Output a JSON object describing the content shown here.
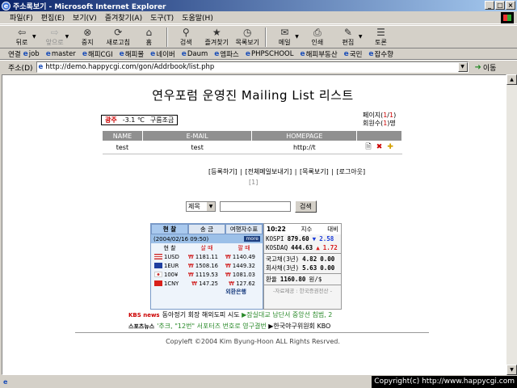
{
  "window": {
    "title": "주소록보기 - Microsoft Internet Explorer",
    "icon": "e"
  },
  "winbuttons": {
    "min": "_",
    "max": "□",
    "close": "×"
  },
  "menu": [
    "파일(F)",
    "편집(E)",
    "보기(V)",
    "즐겨찾기(A)",
    "도구(T)",
    "도움말(H)"
  ],
  "toolbar": {
    "back": "뒤로",
    "forward": "앞으로",
    "stop": "중지",
    "refresh": "새로고침",
    "home": "홈",
    "search": "검색",
    "favorites": "즐겨찾기",
    "history": "목록보기",
    "mail": "메일",
    "print": "인쇄",
    "edit": "편집",
    "discuss": "토론"
  },
  "links": {
    "label": "연결",
    "items": [
      "job",
      "master",
      "해피CGI",
      "해피몰",
      "네이버",
      "Daum",
      "엠파스",
      "PHPSCHOOL",
      "해피부동산",
      "국민",
      "잡수향"
    ]
  },
  "address": {
    "label": "주소(D)",
    "url": "http://demo.happycgi.com/gon/Addrbook/list.php",
    "go": "이동"
  },
  "page": {
    "title": "연우포럼 운영진 Mailing List 리스트",
    "weather": {
      "city": "광주",
      "temp": "-3.1 ℃",
      "desc": "구름조금"
    },
    "pageinfo": {
      "page_label": "페이지(",
      "page_cur": "1",
      "page_sep": "/",
      "page_total": "1",
      "page_end": ")",
      "member_label": "회원수(",
      "member_count": "1",
      "member_end": ")명"
    },
    "table": {
      "headers": [
        "NAME",
        "E-MAIL",
        "HOMEPAGE"
      ],
      "rows": [
        {
          "name": "test",
          "email": "test",
          "homepage": "http://t"
        }
      ]
    },
    "actions": "[등록하기] | [전체메일보내기] | [목록보기] | [로그아웃]",
    "pages": "[1]",
    "search": {
      "field": "제목",
      "button": "검색"
    },
    "fx": {
      "tabs": [
        "현 찰",
        "송 금",
        "여행자수표"
      ],
      "date": "(2004/02/16 09:50)",
      "more": "more",
      "headers": [
        "현 찰",
        "살 때",
        "팔 때"
      ],
      "rows": [
        {
          "cur": "1USD",
          "buy": "1181.11",
          "sell": "1140.49"
        },
        {
          "cur": "1EUR",
          "buy": "1508.16",
          "sell": "1449.32"
        },
        {
          "cur": "100¥",
          "buy": "1119.53",
          "sell": "1081.03"
        },
        {
          "cur": "1CNY",
          "buy": "147.25",
          "sell": "127.62"
        }
      ],
      "won": "₩",
      "footer": "외환은행"
    },
    "stock": {
      "time": "10:22",
      "h1": "지수",
      "h2": "대비",
      "kospi": "KOSPI",
      "kospi_v": "879.60",
      "kospi_d": "2.58",
      "kosdaq": "KOSDAQ",
      "kosdaq_v": "444.63",
      "kosdaq_d": "1.72",
      "b3": "국고채(3년)",
      "b3_v": "4.82",
      "b3_d": "0.00",
      "c3": "회사채(3년)",
      "c3_v": "5.63",
      "c3_d": "0.00",
      "fx": "환율",
      "fx_v": "1160.80",
      "fx_u": "원/$",
      "source": "-자료제공 : 한국증권전산 -"
    },
    "news": {
      "src1": "KBS news",
      "line1a": "동아정기 회장 해외도피 시도 ",
      "line1b": "▶잠실대교 남단서 중앙선 침범, 2",
      "src2": "스포츠뉴스",
      "line2a": "'추크, \"12번\" 서포터즈 번호로 영구결번",
      "line2b": " ▶한국야구위원회 KBO"
    },
    "footer": "Copyleft ©2004 Kim Byung-Hoon ALL Rights Resrved."
  },
  "status": {
    "copyright": "Copyright(c) http://www.happycgi.com"
  }
}
